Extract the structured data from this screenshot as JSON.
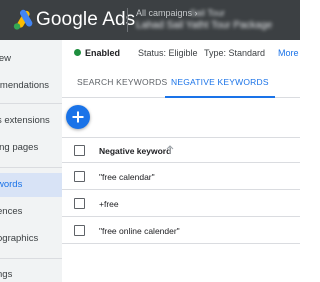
{
  "header": {
    "app_title": "Google Ads",
    "breadcrumb_prefix": "All campaigns ›",
    "breadcrumb_current": "Sail Tour",
    "campaign_name": "Lahad Sail Yatht Tour Package"
  },
  "sidebar": {
    "items": [
      {
        "label": "view"
      },
      {
        "label": "mmendations"
      },
      {
        "label": "s extensions"
      },
      {
        "label": "ing pages"
      },
      {
        "label": "words",
        "active": true
      },
      {
        "label": "ences"
      },
      {
        "label": "ographics"
      },
      {
        "label": "ngs"
      }
    ]
  },
  "status": {
    "state": "Enabled",
    "status_label": "Status: Eligible",
    "type_label": "Type: Standard",
    "more_label": "More"
  },
  "tabs": [
    {
      "label": "SEARCH KEYWORDS",
      "active": false
    },
    {
      "label": "NEGATIVE KEYWORDS",
      "active": true
    }
  ],
  "table": {
    "column_header": "Negative keyword",
    "rows": [
      {
        "keyword": "\"free calendar\""
      },
      {
        "keyword": "+free"
      },
      {
        "keyword": "\"free online calender\""
      }
    ]
  },
  "colors": {
    "topbar": "#3c4043",
    "accent": "#1a73e8",
    "enabled_dot": "#1e8e3e",
    "sidebar_bg": "#f1f3f4",
    "sidebar_active_bg": "#d8e3f6"
  },
  "icons": {
    "logo": "google-ads-logo",
    "fab": "plus-icon",
    "sort": "arrow-up-icon"
  }
}
